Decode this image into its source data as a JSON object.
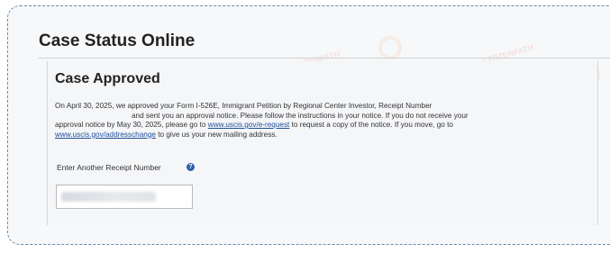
{
  "page": {
    "title": "Case Status Online"
  },
  "status": {
    "heading": "Case Approved",
    "body_line1": "On April 30, 2025, we approved your Form I-526E, Immigrant Petition by Regional Center Investor, Receipt Number",
    "body_line2": "and sent you an approval notice. Please follow the instructions in your notice. If you do not receive your",
    "body_line3_a": "approval notice by May 30, 2025, please go to ",
    "body_link1": "www.uscis.gov/e-request",
    "body_line3_b": " to request a copy of the notice. If you move, go to",
    "body_link2": "www.uscis.gov/addresschange",
    "body_line4": " to give us your new mailing address."
  },
  "receipt": {
    "label": "Enter Another Receipt Number",
    "help_icon": "question-circle-icon"
  },
  "watermark": {
    "text": "CITIZENPATH"
  },
  "colors": {
    "link": "#1d4f9a",
    "frame_border": "#6a86b3",
    "help_icon": "#2f5fa8"
  }
}
